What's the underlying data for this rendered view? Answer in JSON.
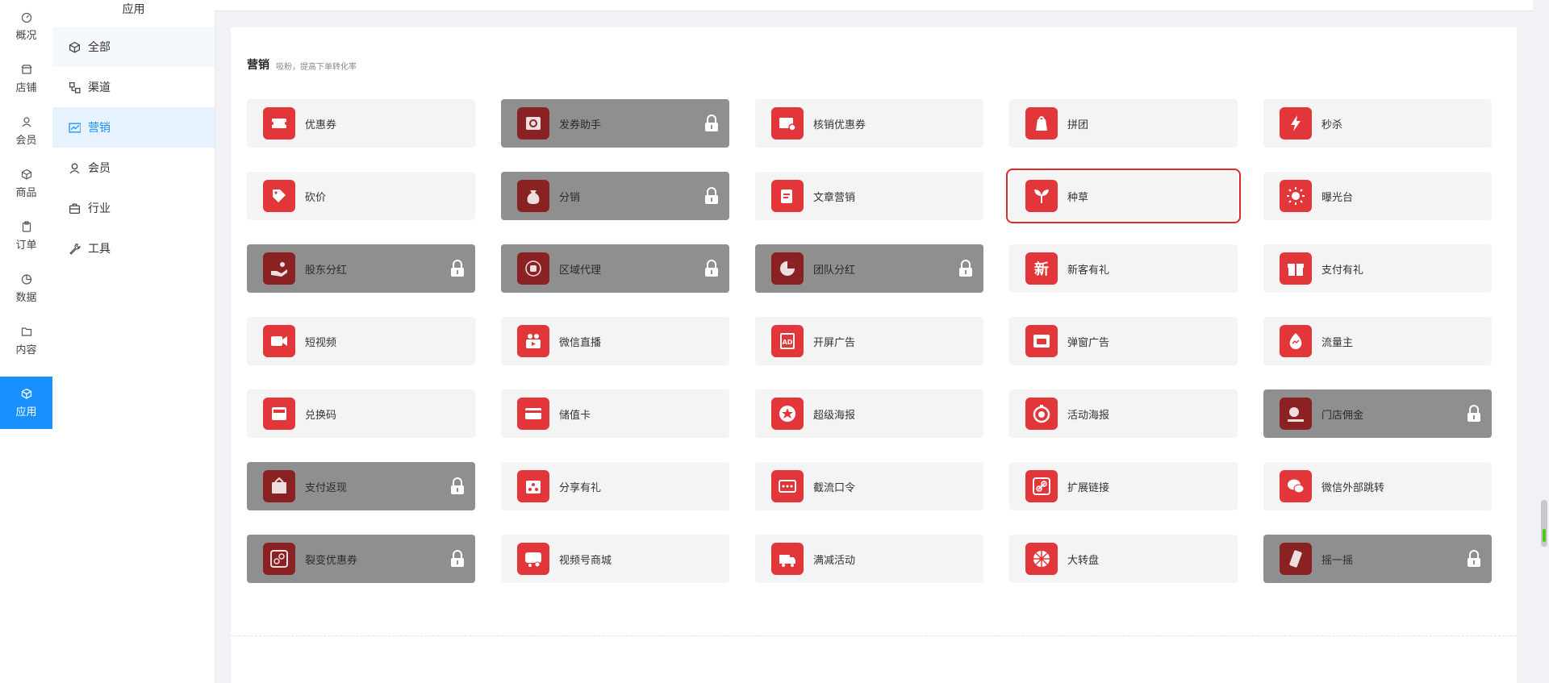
{
  "colors": {
    "accent_blue": "#1890ff",
    "card_red": "#e2363a",
    "locked_gray": "#8f8f8f",
    "selected_outline": "#e0272b"
  },
  "rail": {
    "items": [
      {
        "label": "概况",
        "icon": "dashboard-icon"
      },
      {
        "label": "店铺",
        "icon": "store-icon"
      },
      {
        "label": "会员",
        "icon": "user-icon"
      },
      {
        "label": "商品",
        "icon": "cube-icon"
      },
      {
        "label": "订单",
        "icon": "clipboard-icon"
      },
      {
        "label": "数据",
        "icon": "pie-chart-icon"
      },
      {
        "label": "内容",
        "icon": "folder-icon"
      },
      {
        "label": "应用",
        "icon": "app-cube-icon",
        "active": true
      }
    ]
  },
  "submenu": {
    "title": "应用",
    "items": [
      {
        "label": "全部",
        "icon": "cube-icon"
      },
      {
        "label": "渠道",
        "icon": "channel-icon"
      },
      {
        "label": "营销",
        "icon": "trend-chart-icon",
        "active": true
      },
      {
        "label": "会员",
        "icon": "user-icon"
      },
      {
        "label": "行业",
        "icon": "briefcase-icon"
      },
      {
        "label": "工具",
        "icon": "wrench-icon"
      }
    ]
  },
  "section": {
    "title": "营销",
    "subtitle": "吸粉，提高下单转化率"
  },
  "cards": [
    {
      "label": "优惠券",
      "icon": "coupon-icon",
      "locked": false
    },
    {
      "label": "发券助手",
      "icon": "coupon-assistant-icon",
      "locked": true
    },
    {
      "label": "核销优惠券",
      "icon": "verify-coupon-icon",
      "locked": false
    },
    {
      "label": "拼团",
      "icon": "group-buy-icon",
      "locked": false
    },
    {
      "label": "秒杀",
      "icon": "lightning-icon",
      "locked": false
    },
    {
      "label": "砍价",
      "icon": "bargain-icon",
      "locked": false
    },
    {
      "label": "分销",
      "icon": "money-bag-icon",
      "locked": true
    },
    {
      "label": "文章营销",
      "icon": "article-icon",
      "locked": false
    },
    {
      "label": "种草",
      "icon": "sprout-icon",
      "locked": false,
      "selected": true
    },
    {
      "label": "曝光台",
      "icon": "sun-icon",
      "locked": false
    },
    {
      "label": "股东分红",
      "icon": "dividend-hand-icon",
      "locked": true
    },
    {
      "label": "区域代理",
      "icon": "coins-icon",
      "locked": true
    },
    {
      "label": "团队分红",
      "icon": "team-pie-icon",
      "locked": true
    },
    {
      "label": "新客有礼",
      "icon": "new-customer-icon",
      "locked": false
    },
    {
      "label": "支付有礼",
      "icon": "gift-icon",
      "locked": false
    },
    {
      "label": "短视频",
      "icon": "video-camera-icon",
      "locked": false
    },
    {
      "label": "微信直播",
      "icon": "live-stream-icon",
      "locked": false
    },
    {
      "label": "开屏广告",
      "icon": "ad-icon",
      "locked": false
    },
    {
      "label": "弹窗广告",
      "icon": "popup-ad-icon",
      "locked": false
    },
    {
      "label": "流量主",
      "icon": "traffic-drop-icon",
      "locked": false
    },
    {
      "label": "兑换码",
      "icon": "redeem-code-icon",
      "locked": false
    },
    {
      "label": "储值卡",
      "icon": "card-icon",
      "locked": false
    },
    {
      "label": "超级海报",
      "icon": "star-poster-icon",
      "locked": false
    },
    {
      "label": "活动海报",
      "icon": "activity-poster-icon",
      "locked": false
    },
    {
      "label": "门店佣金",
      "icon": "store-commission-icon",
      "locked": true
    },
    {
      "label": "支付返现",
      "icon": "cashback-icon",
      "locked": true
    },
    {
      "label": "分享有礼",
      "icon": "share-gift-icon",
      "locked": false
    },
    {
      "label": "截流口令",
      "icon": "password-icon",
      "locked": false
    },
    {
      "label": "扩展链接",
      "icon": "link-icon",
      "locked": false
    },
    {
      "label": "微信外部跳转",
      "icon": "wechat-icon",
      "locked": false
    },
    {
      "label": "裂变优惠券",
      "icon": "fission-coupon-icon",
      "locked": true
    },
    {
      "label": "视频号商城",
      "icon": "video-mall-icon",
      "locked": false
    },
    {
      "label": "满减活动",
      "icon": "discount-truck-icon",
      "locked": false
    },
    {
      "label": "大转盘",
      "icon": "wheel-icon",
      "locked": false
    },
    {
      "label": "摇一摇",
      "icon": "shake-icon",
      "locked": true
    }
  ]
}
